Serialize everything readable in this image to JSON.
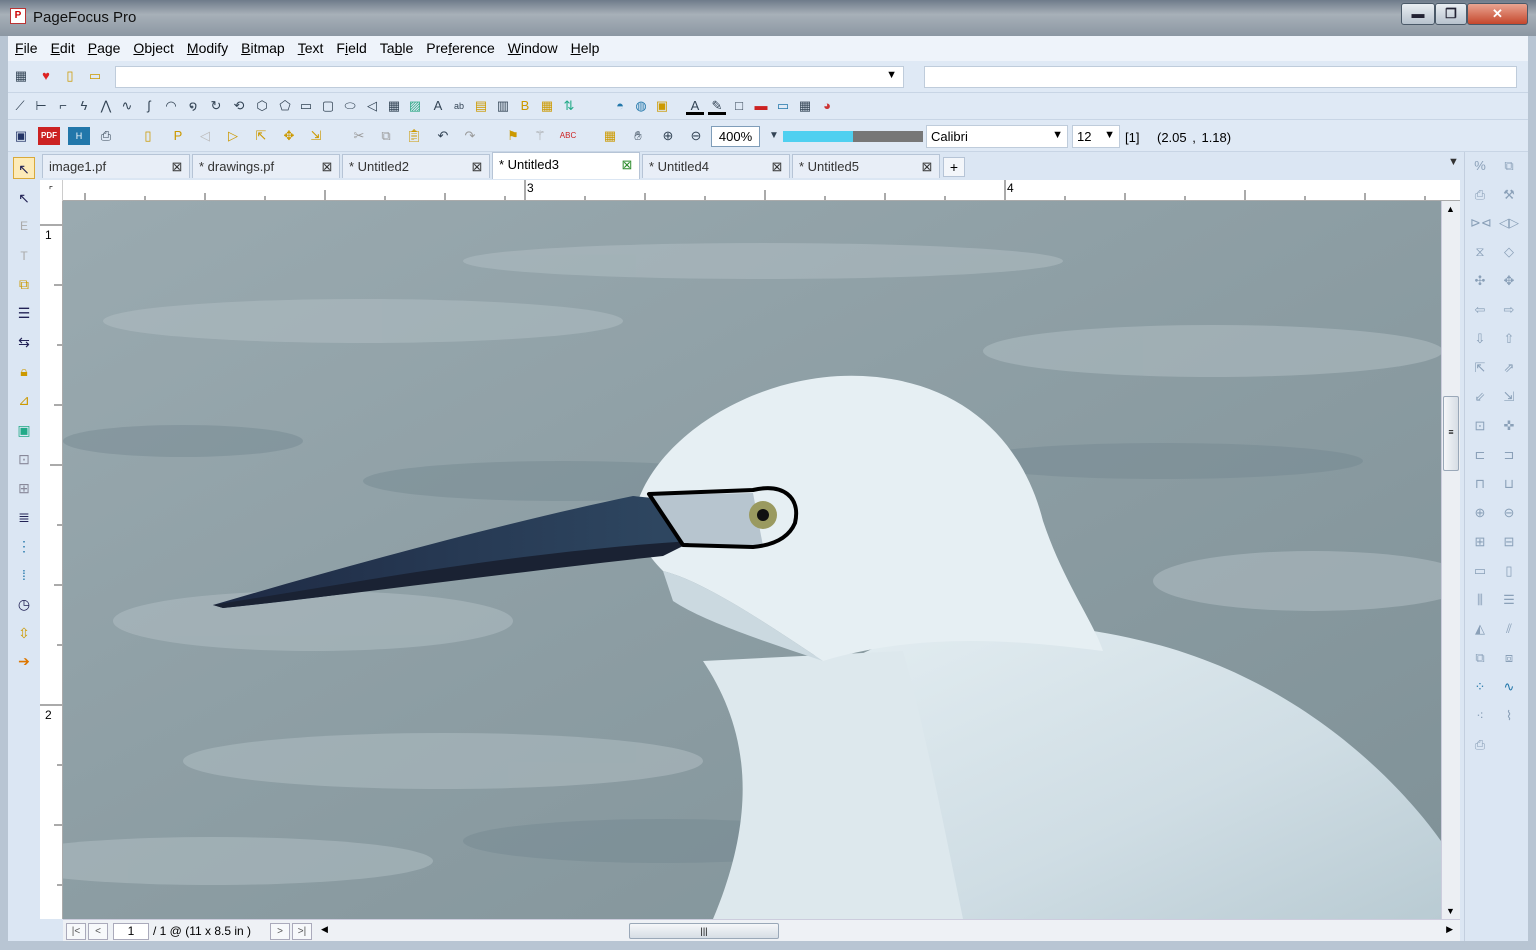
{
  "app": {
    "title": "PageFocus Pro",
    "icon": "app-logo-icon"
  },
  "window_controls": {
    "minimize": "▬",
    "maximize": "❐",
    "close": "✕"
  },
  "menu": [
    {
      "label": "File",
      "u": "F",
      "rest": "ile"
    },
    {
      "label": "Edit",
      "u": "E",
      "rest": "dit"
    },
    {
      "label": "Page",
      "u": "P",
      "rest": "age"
    },
    {
      "label": "Object",
      "u": "O",
      "rest": "bject"
    },
    {
      "label": "Modify",
      "u": "M",
      "rest": "odify"
    },
    {
      "label": "Bitmap",
      "u": "B",
      "rest": "itmap"
    },
    {
      "label": "Text",
      "u": "T",
      "rest": "ext"
    },
    {
      "label": "Field",
      "pre": "F",
      "u": "i",
      "rest": "eld"
    },
    {
      "label": "Table",
      "pre": "Ta",
      "u": "b",
      "rest": "le"
    },
    {
      "label": "Preference",
      "pre": "Pre",
      "u": "f",
      "rest": "erence"
    },
    {
      "label": "Window",
      "u": "W",
      "rest": "indow"
    },
    {
      "label": "Help",
      "u": "H",
      "rest": "elp"
    }
  ],
  "toolbar": {
    "combo1_value": "",
    "combo2_value": "",
    "zoom": "400%",
    "zoom_slider_fraction": 0.5,
    "font": "Calibri",
    "font_size": "12",
    "page_indicator": "[1]",
    "coords": "(2.05 ,   1.18)"
  },
  "tabs": [
    {
      "label": "image1.pf",
      "active": false
    },
    {
      "label": "* drawings.pf",
      "active": false
    },
    {
      "label": "* Untitled2",
      "active": false
    },
    {
      "label": "* Untitled3",
      "active": true
    },
    {
      "label": "* Untitled4",
      "active": false
    },
    {
      "label": "* Untitled5",
      "active": false
    }
  ],
  "ruler": {
    "top_labels": [
      "3",
      "4"
    ],
    "left_labels": [
      "1",
      "2"
    ]
  },
  "canvas": {
    "subject": "egret-photo"
  },
  "status": {
    "first": "|<",
    "prev": "<",
    "page": "1",
    "total": "/ 1 @ (11 x 8.5 in )",
    "next": ">",
    "last": ">|"
  },
  "colors": {
    "accent": "#4fd0f0",
    "menubar": "#eef3fa",
    "toolbar": "#dfe9f5"
  }
}
